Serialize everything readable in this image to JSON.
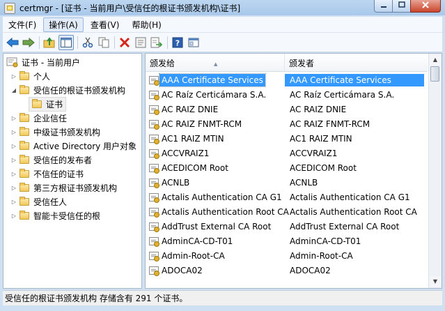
{
  "window": {
    "title": "certmgr - [证书 - 当前用户\\受信任的根证书颁发机构\\证书]"
  },
  "menu": [
    {
      "label": "文件(F)"
    },
    {
      "label": "操作(A)"
    },
    {
      "label": "查看(V)"
    },
    {
      "label": "帮助(H)"
    }
  ],
  "toolbar": [
    {
      "icon": "back-arrow-icon"
    },
    {
      "icon": "forward-arrow-icon"
    },
    {
      "icon": "up-folder-icon"
    },
    {
      "icon": "show-hide-tree-icon"
    },
    {
      "icon": "cut-icon"
    },
    {
      "icon": "copy-icon"
    },
    {
      "icon": "delete-icon"
    },
    {
      "icon": "properties-icon"
    },
    {
      "icon": "export-list-icon"
    },
    {
      "icon": "help-icon"
    },
    {
      "icon": "view-icon"
    }
  ],
  "tree": {
    "root": "证书 - 当前用户",
    "items": [
      {
        "label": "个人"
      },
      {
        "label": "受信任的根证书颁发机构"
      },
      {
        "label": "证书"
      },
      {
        "label": "企业信任"
      },
      {
        "label": "中级证书颁发机构"
      },
      {
        "label": "Active Directory 用户对象"
      },
      {
        "label": "受信任的发布者"
      },
      {
        "label": "不信任的证书"
      },
      {
        "label": "第三方根证书颁发机构"
      },
      {
        "label": "受信任人"
      },
      {
        "label": "智能卡受信任的根"
      }
    ]
  },
  "list": {
    "columns": [
      "颁发给",
      "颁发者"
    ],
    "rows": [
      [
        "AAA Certificate Services",
        "AAA Certificate Services"
      ],
      [
        "AC Raíz Certicámara S.A.",
        "AC Raíz Certicámara S.A."
      ],
      [
        "AC RAIZ DNIE",
        "AC RAIZ DNIE"
      ],
      [
        "AC RAIZ FNMT-RCM",
        "AC RAIZ FNMT-RCM"
      ],
      [
        "AC1 RAIZ MTIN",
        "AC1 RAIZ MTIN"
      ],
      [
        "ACCVRAIZ1",
        "ACCVRAIZ1"
      ],
      [
        "ACEDICOM Root",
        "ACEDICOM Root"
      ],
      [
        "ACNLB",
        "ACNLB"
      ],
      [
        "Actalis Authentication CA G1",
        "Actalis Authentication CA G1"
      ],
      [
        "Actalis Authentication Root CA",
        "Actalis Authentication Root CA"
      ],
      [
        "AddTrust External CA Root",
        "AddTrust External CA Root"
      ],
      [
        "AdminCA-CD-T01",
        "AdminCA-CD-T01"
      ],
      [
        "Admin-Root-CA",
        "Admin-Root-CA"
      ],
      [
        "ADOCA02",
        "ADOCA02"
      ]
    ]
  },
  "status": {
    "text": "受信任的根证书颁发机构 存储含有 291 个证书。"
  }
}
